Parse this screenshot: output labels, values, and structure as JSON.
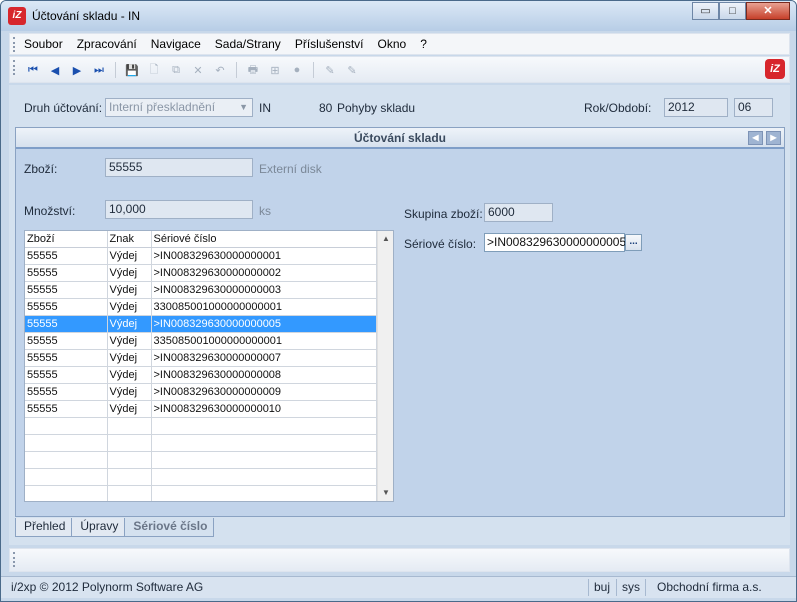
{
  "window": {
    "title": "Účtování skladu - IN",
    "app_icon_text": "iZ",
    "min_glyph": "▭",
    "max_glyph": "□",
    "close_glyph": "✕"
  },
  "menu": [
    "Soubor",
    "Zpracování",
    "Navigace",
    "Sada/Strany",
    "Příslušenství",
    "Okno",
    "?"
  ],
  "toolbar": {
    "icons": [
      "first-record-icon",
      "previous-record-icon",
      "next-record-icon",
      "last-record-icon",
      "save-icon",
      "new-record-icon",
      "copy-icon",
      "delete-icon",
      "undo-icon",
      "print-icon",
      "tree-icon",
      "disabled-circle-icon",
      "edit-icon",
      "edit-light-icon"
    ],
    "glyphs": [
      "⏮",
      "◀",
      "▶",
      "⏭",
      "💾",
      "🗋",
      "⧉",
      "✕",
      "↶",
      "🖶",
      "⊞",
      "●",
      "✎",
      "✎"
    ],
    "logo_text": "iZ"
  },
  "header": {
    "druh_label": "Druh účtování:",
    "druh_value": "Interní přeskladnění",
    "druh_code": "IN",
    "pohyby_number": "80",
    "pohyby_label": "Pohyby skladu",
    "rok_label": "Rok/Období:",
    "rok_value": "2012",
    "obdobi_value": "06"
  },
  "panel": {
    "title": "Účtování skladu",
    "zbozi_label": "Zboží:",
    "zbozi_value": "55555",
    "zbozi_desc": "Externí disk",
    "mnozstvi_label": "Množství:",
    "mnozstvi_value": "10,000",
    "mnozstvi_unit": "ks",
    "skupina_label": "Skupina zboží:",
    "skupina_value": "6000",
    "seriove_label": "Sériové číslo:",
    "seriove_value": ">IN008329630000000005",
    "dots_label": "..."
  },
  "grid": {
    "columns": [
      "Zboží",
      "Znak",
      "Sériové číslo"
    ],
    "rows": [
      [
        "55555",
        "Výdej",
        ">IN008329630000000001"
      ],
      [
        "55555",
        "Výdej",
        ">IN008329630000000002"
      ],
      [
        "55555",
        "Výdej",
        ">IN008329630000000003"
      ],
      [
        "55555",
        "Výdej",
        "330085001000000000001"
      ],
      [
        "55555",
        "Výdej",
        ">IN008329630000000005"
      ],
      [
        "55555",
        "Výdej",
        "335085001000000000001"
      ],
      [
        "55555",
        "Výdej",
        ">IN008329630000000007"
      ],
      [
        "55555",
        "Výdej",
        ">IN008329630000000008"
      ],
      [
        "55555",
        "Výdej",
        ">IN008329630000000009"
      ],
      [
        "55555",
        "Výdej",
        ">IN008329630000000010"
      ]
    ],
    "selected_row": 4,
    "empty_rows": 5
  },
  "tabs": [
    "Přehled",
    "Úpravy",
    "Sériové číslo"
  ],
  "active_tab": 2,
  "status": {
    "copyright": "i/2xp © 2012 Polynorm Software AG",
    "user": "buj",
    "system": "sys",
    "company": "Obchodní firma a.s."
  }
}
